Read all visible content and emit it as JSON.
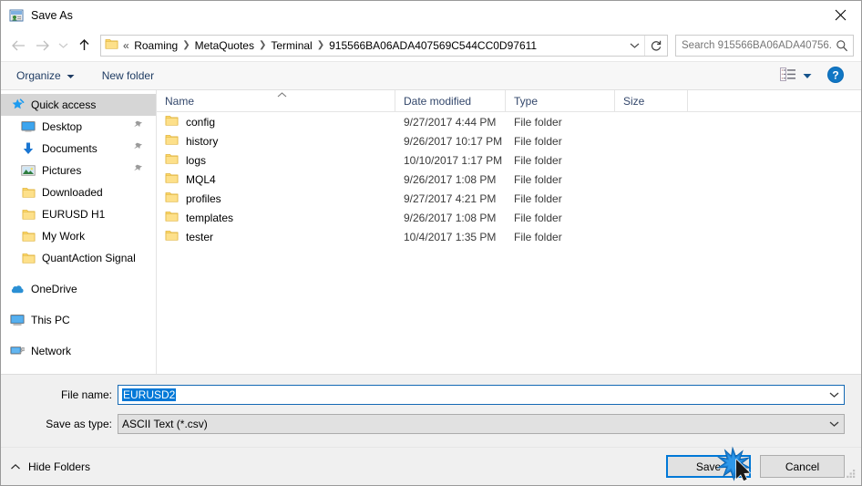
{
  "window": {
    "title": "Save As",
    "title_icon": "save-as-icon",
    "close_icon": "close-icon"
  },
  "nav": {
    "back_icon": "back-arrow-icon",
    "forward_icon": "forward-arrow-icon",
    "recent_icon": "chevron-down-icon",
    "up_icon": "up-arrow-icon",
    "breadcrumbs": [
      "Roaming",
      "MetaQuotes",
      "Terminal",
      "915566BA06ADA407569C544CC0D97611"
    ],
    "breadcrumb_overflow": "«",
    "address_chevron_icon": "chevron-down-icon",
    "refresh_icon": "refresh-icon"
  },
  "search": {
    "placeholder": "Search 915566BA06ADA40756...",
    "icon": "search-icon"
  },
  "toolbar": {
    "organize_label": "Organize",
    "organize_caret_icon": "caret-down-icon",
    "new_folder_label": "New folder",
    "view_icon": "view-layout-icon",
    "view_caret_icon": "caret-down-icon",
    "help_icon": "help-icon",
    "help_label": "?"
  },
  "sidebar": {
    "items": [
      {
        "label": "Quick access",
        "icon": "star-pin-icon",
        "level": 0,
        "selected": true,
        "pinned": false
      },
      {
        "label": "Desktop",
        "icon": "desktop-icon",
        "level": 1,
        "selected": false,
        "pinned": true
      },
      {
        "label": "Documents",
        "icon": "documents-icon",
        "level": 1,
        "selected": false,
        "pinned": true
      },
      {
        "label": "Pictures",
        "icon": "pictures-icon",
        "level": 1,
        "selected": false,
        "pinned": true
      },
      {
        "label": "Downloaded",
        "icon": "folder-icon",
        "level": 1,
        "selected": false,
        "pinned": false
      },
      {
        "label": "EURUSD H1",
        "icon": "folder-icon",
        "level": 1,
        "selected": false,
        "pinned": false
      },
      {
        "label": "My Work",
        "icon": "folder-icon",
        "level": 1,
        "selected": false,
        "pinned": false
      },
      {
        "label": "QuantAction Signal",
        "icon": "folder-icon",
        "level": 1,
        "selected": false,
        "pinned": false
      },
      {
        "label": "OneDrive",
        "icon": "onedrive-icon",
        "level": 0,
        "selected": false,
        "pinned": false,
        "gap_before": true
      },
      {
        "label": "This PC",
        "icon": "this-pc-icon",
        "level": 0,
        "selected": false,
        "pinned": false,
        "gap_before": true
      },
      {
        "label": "Network",
        "icon": "network-icon",
        "level": 0,
        "selected": false,
        "pinned": false,
        "gap_before": true
      }
    ]
  },
  "filelist": {
    "columns": [
      "Name",
      "Date modified",
      "Type",
      "Size"
    ],
    "sort_column": "Name",
    "sort_direction": "ascending",
    "rows": [
      {
        "name": "config",
        "date": "9/27/2017 4:44 PM",
        "type": "File folder",
        "size": ""
      },
      {
        "name": "history",
        "date": "9/26/2017 10:17 PM",
        "type": "File folder",
        "size": ""
      },
      {
        "name": "logs",
        "date": "10/10/2017 1:17 PM",
        "type": "File folder",
        "size": ""
      },
      {
        "name": "MQL4",
        "date": "9/26/2017 1:08 PM",
        "type": "File folder",
        "size": ""
      },
      {
        "name": "profiles",
        "date": "9/27/2017 4:21 PM",
        "type": "File folder",
        "size": ""
      },
      {
        "name": "templates",
        "date": "9/26/2017 1:08 PM",
        "type": "File folder",
        "size": ""
      },
      {
        "name": "tester",
        "date": "10/4/2017 1:35 PM",
        "type": "File folder",
        "size": ""
      }
    ]
  },
  "form": {
    "filename_label": "File name:",
    "filename_value": "EURUSD2",
    "filename_selected": true,
    "filetype_label": "Save as type:",
    "filetype_value": "ASCII Text (*.csv)",
    "dropdown_icon": "chevron-down-icon"
  },
  "footer": {
    "hide_folders_label": "Hide Folders",
    "hide_folders_icon": "chevron-up-icon",
    "save_label": "Save",
    "cancel_label": "Cancel",
    "default_button": "Save",
    "resize_grip_icon": "resize-grip-icon",
    "cursor_icon": "mouse-pointer-icon",
    "click_burst_icon": "click-burst-icon"
  },
  "colors": {
    "accent": "#0078d7",
    "folder_yellow": "#ffd966",
    "selection_grey": "#d6d6d6",
    "header_text": "#33476b",
    "window_bg": "#f0f0f0"
  }
}
